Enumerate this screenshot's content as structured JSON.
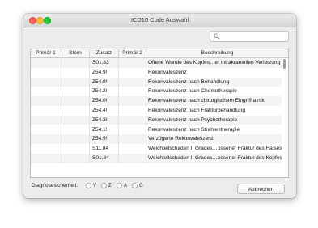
{
  "window": {
    "title": "ICD10 Code Auswahl"
  },
  "search": {
    "placeholder": ""
  },
  "table": {
    "columns": [
      "Primär 1",
      "Stern",
      "Zusatz",
      "Primär 2",
      "Beschreibung"
    ],
    "rows": [
      {
        "zusatz": "S01.83",
        "desc": "Offene Wunde des Kopfes…er intrakraniellen Verletzung"
      },
      {
        "zusatz": "Z54.9!",
        "desc": "Rekonvaleszenz"
      },
      {
        "zusatz": "Z54.9!",
        "desc": "Rekonvaleszenz nach Behandlung"
      },
      {
        "zusatz": "Z54.2!",
        "desc": "Rekonvaleszenz nach Chemotherapie"
      },
      {
        "zusatz": "Z54.0!",
        "desc": "Rekonvaleszenz nach chirurgischem Eingriff a.n.k."
      },
      {
        "zusatz": "Z54.4!",
        "desc": "Rekonvaleszenz nach Frakturbehandlung"
      },
      {
        "zusatz": "Z54.3!",
        "desc": "Rekonvaleszenz nach Psychotherapie"
      },
      {
        "zusatz": "Z54.1!",
        "desc": "Rekonvaleszenz nach Strahlentherapie"
      },
      {
        "zusatz": "Z54.9!",
        "desc": "Verzögerte Rekonvaleszenz"
      },
      {
        "zusatz": "S11.84",
        "desc": "Weichteilschaden I. Grades…ossener Fraktur des Halses"
      },
      {
        "zusatz": "S01.84",
        "desc": "Weichteilschaden I. Grades…ossener Fraktur des Kopfes"
      }
    ]
  },
  "certainty": {
    "label": "Diagnosesicherheit:",
    "options": [
      "V",
      "Z",
      "A",
      "G"
    ]
  },
  "buttons": {
    "cancel": "Abbrechen"
  }
}
